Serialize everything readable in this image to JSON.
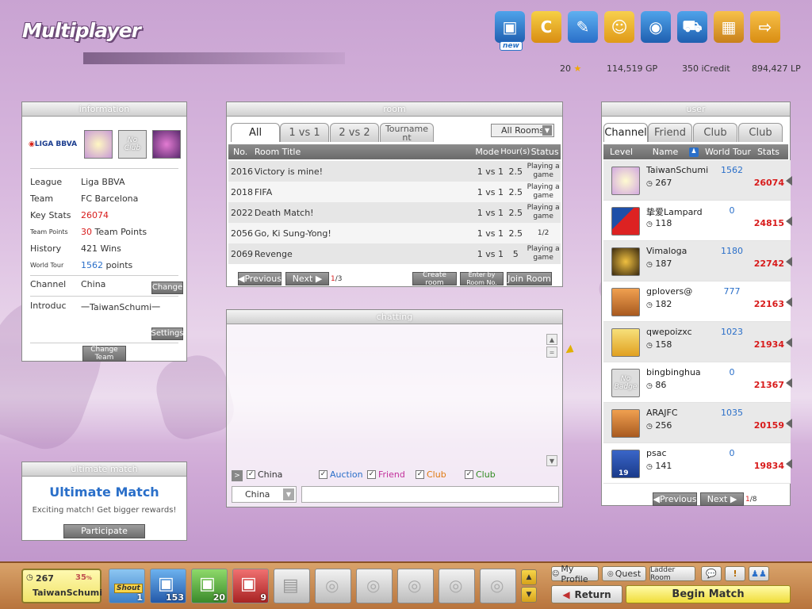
{
  "header": {
    "title": "Multiplayer",
    "new_badge": "new",
    "stars": "20",
    "gp": "114,519 GP",
    "icredit": "350 iCredit",
    "lp": "894,427 LP"
  },
  "info": {
    "title": "information",
    "league_logo": "LIGA BBVA",
    "noclub_badge": "No Club",
    "rows": [
      {
        "key": "League",
        "value": "Liga BBVA"
      },
      {
        "key": "Team",
        "value": "FC Barcelona"
      },
      {
        "key": "Key Stats",
        "value": "26074"
      },
      {
        "key": "Team Points",
        "value_num": "30",
        "value_text": "Team Points"
      },
      {
        "key": "History",
        "value": "421 Wins"
      },
      {
        "key": "World Tour",
        "value_num": "1562",
        "value_text": "points"
      },
      {
        "key": "Channel",
        "value": "China"
      },
      {
        "key": "Introduc",
        "value": "一TaiwanSchumi一"
      }
    ],
    "change_label": "Change",
    "settings_label": "Settings",
    "change_team_label": "Change Team"
  },
  "ultimate": {
    "title": "ultimate match",
    "heading": "Ultimate Match",
    "desc": "Exciting match! Get bigger rewards!",
    "button": "Participate"
  },
  "room": {
    "title": "room",
    "tabs": [
      "All",
      "1 vs 1",
      "2 vs 2",
      "Tournament"
    ],
    "filter": "All Rooms",
    "columns": [
      "No.",
      "Room Title",
      "Mode",
      "Hour(s)",
      "Status"
    ],
    "rows": [
      {
        "no": "2016",
        "title": "Victory is mine!",
        "mode": "1 vs 1",
        "hours": "2.5",
        "status": "Playing a game"
      },
      {
        "no": "2018",
        "title": "FIFA",
        "mode": "1 vs 1",
        "hours": "2.5",
        "status": "Playing a game"
      },
      {
        "no": "2022",
        "title": "Death Match!",
        "mode": "1 vs 1",
        "hours": "2.5",
        "status": "Playing a game"
      },
      {
        "no": "2056",
        "title": "Go, Ki Sung-Yong!",
        "mode": "1 vs 1",
        "hours": "2.5",
        "status": "1/2"
      },
      {
        "no": "2069",
        "title": "Revenge",
        "mode": "1 vs 1",
        "hours": "5",
        "status": "Playing a game"
      }
    ],
    "prev": "Previous",
    "next": "Next",
    "page": "1",
    "total": "/3",
    "create_room": "Create room",
    "enter_room_no": "Enter by Room No.",
    "join_room": "Join Room"
  },
  "chat": {
    "title": "chatting",
    "filters": [
      {
        "label": "China",
        "color": "#333333"
      },
      {
        "label": "Auction",
        "color": "#2a6fc9"
      },
      {
        "label": "Friend",
        "color": "#c2309b"
      },
      {
        "label": "Club",
        "color": "#e07a10"
      },
      {
        "label": "Club",
        "color": "#2f8a1f"
      }
    ],
    "channel": "China"
  },
  "user": {
    "title": "user",
    "tabs": [
      "Channel",
      "Friend",
      "Club",
      "Club"
    ],
    "columns": [
      "Level",
      "Name",
      "World Tour",
      "Stats"
    ],
    "rows": [
      {
        "name": "TaiwanSchumi",
        "level": "267",
        "wt": "1562",
        "stats": "26074"
      },
      {
        "name": "挚爱Lampard",
        "level": "118",
        "wt": "0",
        "stats": "24815"
      },
      {
        "name": "Vimaloga",
        "level": "187",
        "wt": "1180",
        "stats": "22742"
      },
      {
        "name": "gplovers@",
        "level": "182",
        "wt": "777",
        "stats": "22163"
      },
      {
        "name": "qwepoizxc",
        "level": "158",
        "wt": "1023",
        "stats": "21934"
      },
      {
        "name": "bingbinghua",
        "level": "86",
        "wt": "0",
        "stats": "21367"
      },
      {
        "name": "ARAJFC",
        "level": "256",
        "wt": "1035",
        "stats": "20159"
      },
      {
        "name": "psac",
        "level": "141",
        "wt": "0",
        "stats": "19834"
      }
    ],
    "nobadge": "No Badge",
    "badge_num": "19",
    "prev": "Previous",
    "next": "Next",
    "page": "1",
    "total": "/8"
  },
  "bottom": {
    "level": "267",
    "percent": "35",
    "percent_sign": "%",
    "name": "TaiwanSchumi",
    "shout": "Shout",
    "slot_counts": [
      "1",
      "153",
      "20",
      "9"
    ],
    "my_profile": "My Profile",
    "quest": "Quest",
    "ladder_room": "Ladder Room",
    "return": "Return",
    "begin_match": "Begin Match"
  }
}
